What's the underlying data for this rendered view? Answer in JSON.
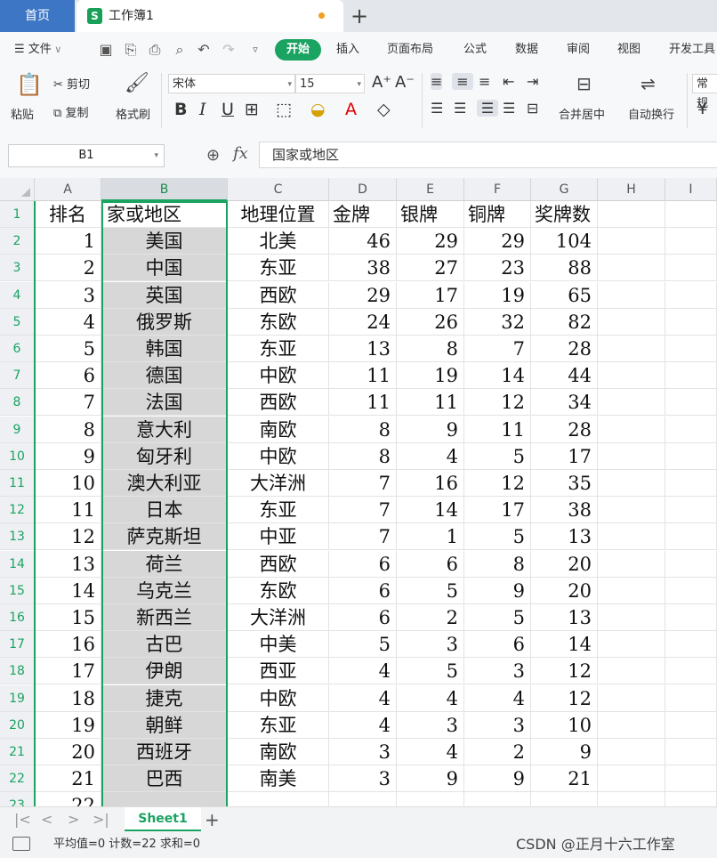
{
  "tabs": {
    "home": "首页",
    "doc_icon": "S",
    "doc_title": "工作簿1"
  },
  "menu": {
    "file": "文件",
    "items": [
      "开始",
      "插入",
      "页面布局",
      "公式",
      "数据",
      "审阅",
      "视图",
      "开发工具"
    ]
  },
  "ribbon": {
    "paste": "粘贴",
    "cut": "剪切",
    "copy": "复制",
    "format_painter": "格式刷",
    "font_name": "宋体",
    "font_size": "15",
    "bold": "B",
    "italic": "I",
    "underline": "U",
    "merge_center": "合并居中",
    "wrap_text": "自动换行",
    "number_format": "常规"
  },
  "formula_bar": {
    "name_box": "B1",
    "fx_label": "fx",
    "formula": "国家或地区"
  },
  "grid": {
    "columns": [
      "A",
      "B",
      "C",
      "D",
      "E",
      "F",
      "G",
      "H",
      "I"
    ],
    "selected_column": "B",
    "header": [
      "排名",
      "家或地区",
      "地理位置",
      "金牌",
      "银牌",
      "铜牌",
      "奖牌数"
    ],
    "rows": [
      [
        "1",
        "美国",
        "北美",
        "46",
        "29",
        "29",
        "104"
      ],
      [
        "2",
        "中国",
        "东亚",
        "38",
        "27",
        "23",
        "88"
      ],
      [
        "3",
        "英国",
        "西欧",
        "29",
        "17",
        "19",
        "65"
      ],
      [
        "4",
        "俄罗斯",
        "东欧",
        "24",
        "26",
        "32",
        "82"
      ],
      [
        "5",
        "韩国",
        "东亚",
        "13",
        "8",
        "7",
        "28"
      ],
      [
        "6",
        "德国",
        "中欧",
        "11",
        "19",
        "14",
        "44"
      ],
      [
        "7",
        "法国",
        "西欧",
        "11",
        "11",
        "12",
        "34"
      ],
      [
        "8",
        "意大利",
        "南欧",
        "8",
        "9",
        "11",
        "28"
      ],
      [
        "9",
        "匈牙利",
        "中欧",
        "8",
        "4",
        "5",
        "17"
      ],
      [
        "10",
        "澳大利亚",
        "大洋洲",
        "7",
        "16",
        "12",
        "35"
      ],
      [
        "11",
        "日本",
        "东亚",
        "7",
        "14",
        "17",
        "38"
      ],
      [
        "12",
        "萨克斯坦",
        "中亚",
        "7",
        "1",
        "5",
        "13"
      ],
      [
        "13",
        "荷兰",
        "西欧",
        "6",
        "6",
        "8",
        "20"
      ],
      [
        "14",
        "乌克兰",
        "东欧",
        "6",
        "5",
        "9",
        "20"
      ],
      [
        "15",
        "新西兰",
        "大洋洲",
        "6",
        "2",
        "5",
        "13"
      ],
      [
        "16",
        "古巴",
        "中美",
        "5",
        "3",
        "6",
        "14"
      ],
      [
        "17",
        "伊朗",
        "西亚",
        "4",
        "5",
        "3",
        "12"
      ],
      [
        "18",
        "捷克",
        "中欧",
        "4",
        "4",
        "4",
        "12"
      ],
      [
        "19",
        "朝鲜",
        "东亚",
        "4",
        "3",
        "3",
        "10"
      ],
      [
        "20",
        "西班牙",
        "南欧",
        "3",
        "4",
        "2",
        "9"
      ],
      [
        "21",
        "巴西",
        "南美",
        "3",
        "9",
        "9",
        "21"
      ],
      [
        "22",
        "",
        "",
        "",
        "",
        "",
        ""
      ]
    ],
    "row_numbers": [
      "1",
      "2",
      "3",
      "4",
      "5",
      "6",
      "7",
      "8",
      "9",
      "10",
      "11",
      "12",
      "13",
      "14",
      "15",
      "16",
      "17",
      "18",
      "19",
      "20",
      "21",
      "22",
      "23"
    ]
  },
  "sheets": {
    "active": "Sheet1",
    "add": "+"
  },
  "status": {
    "text": "平均值=0  计数=22  求和=0",
    "watermark": "CSDN @正月十六工作室"
  },
  "colors": {
    "accent": "#1aa361",
    "home_tab": "#3d76c5",
    "selection": "#d7d7d7"
  }
}
